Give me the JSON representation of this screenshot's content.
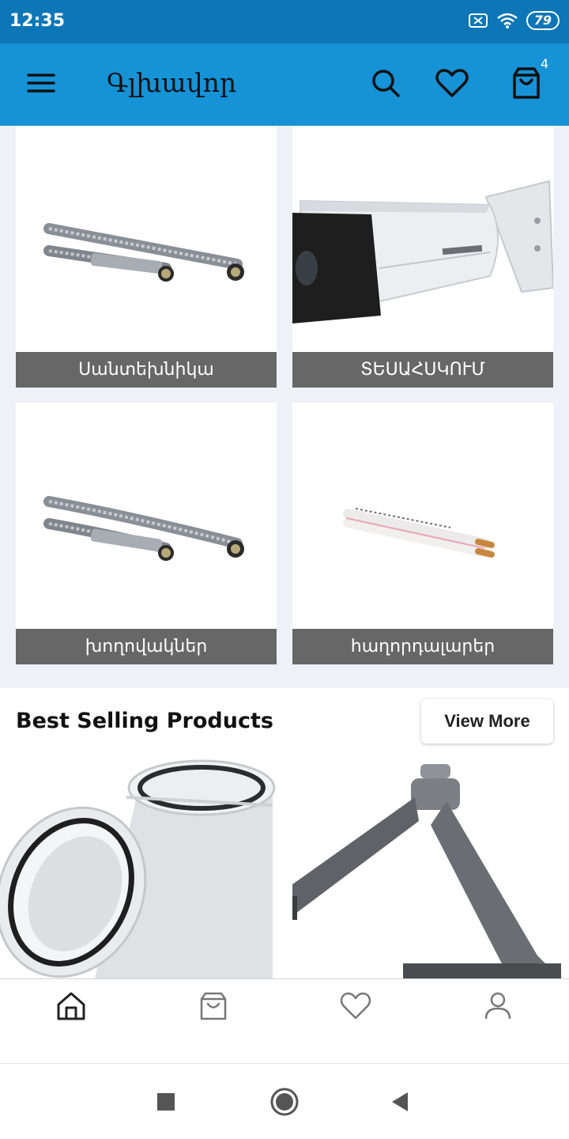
{
  "status_bar": {
    "time": "12:35",
    "battery": "79"
  },
  "app_bar": {
    "title": "Գլխավոր",
    "cart_count": "4"
  },
  "categories": [
    {
      "label": "Սանտեխնիկա",
      "icon": "hose-image"
    },
    {
      "label": "ՏԵՍԱՀՍԿՈՒՄ",
      "icon": "camera-image"
    },
    {
      "label": "խողովակներ",
      "icon": "hose-image"
    },
    {
      "label": "հաղորդալարեր",
      "icon": "cable-image"
    }
  ],
  "best_selling": {
    "title": "Best Selling Products",
    "view_more": "View More"
  },
  "bottom_nav": [
    "home-icon",
    "cart-icon",
    "heart-icon",
    "user-icon"
  ],
  "colors": {
    "status_bar": "#0c76b6",
    "app_bar": "#1692d6",
    "category_label": "#676767"
  }
}
